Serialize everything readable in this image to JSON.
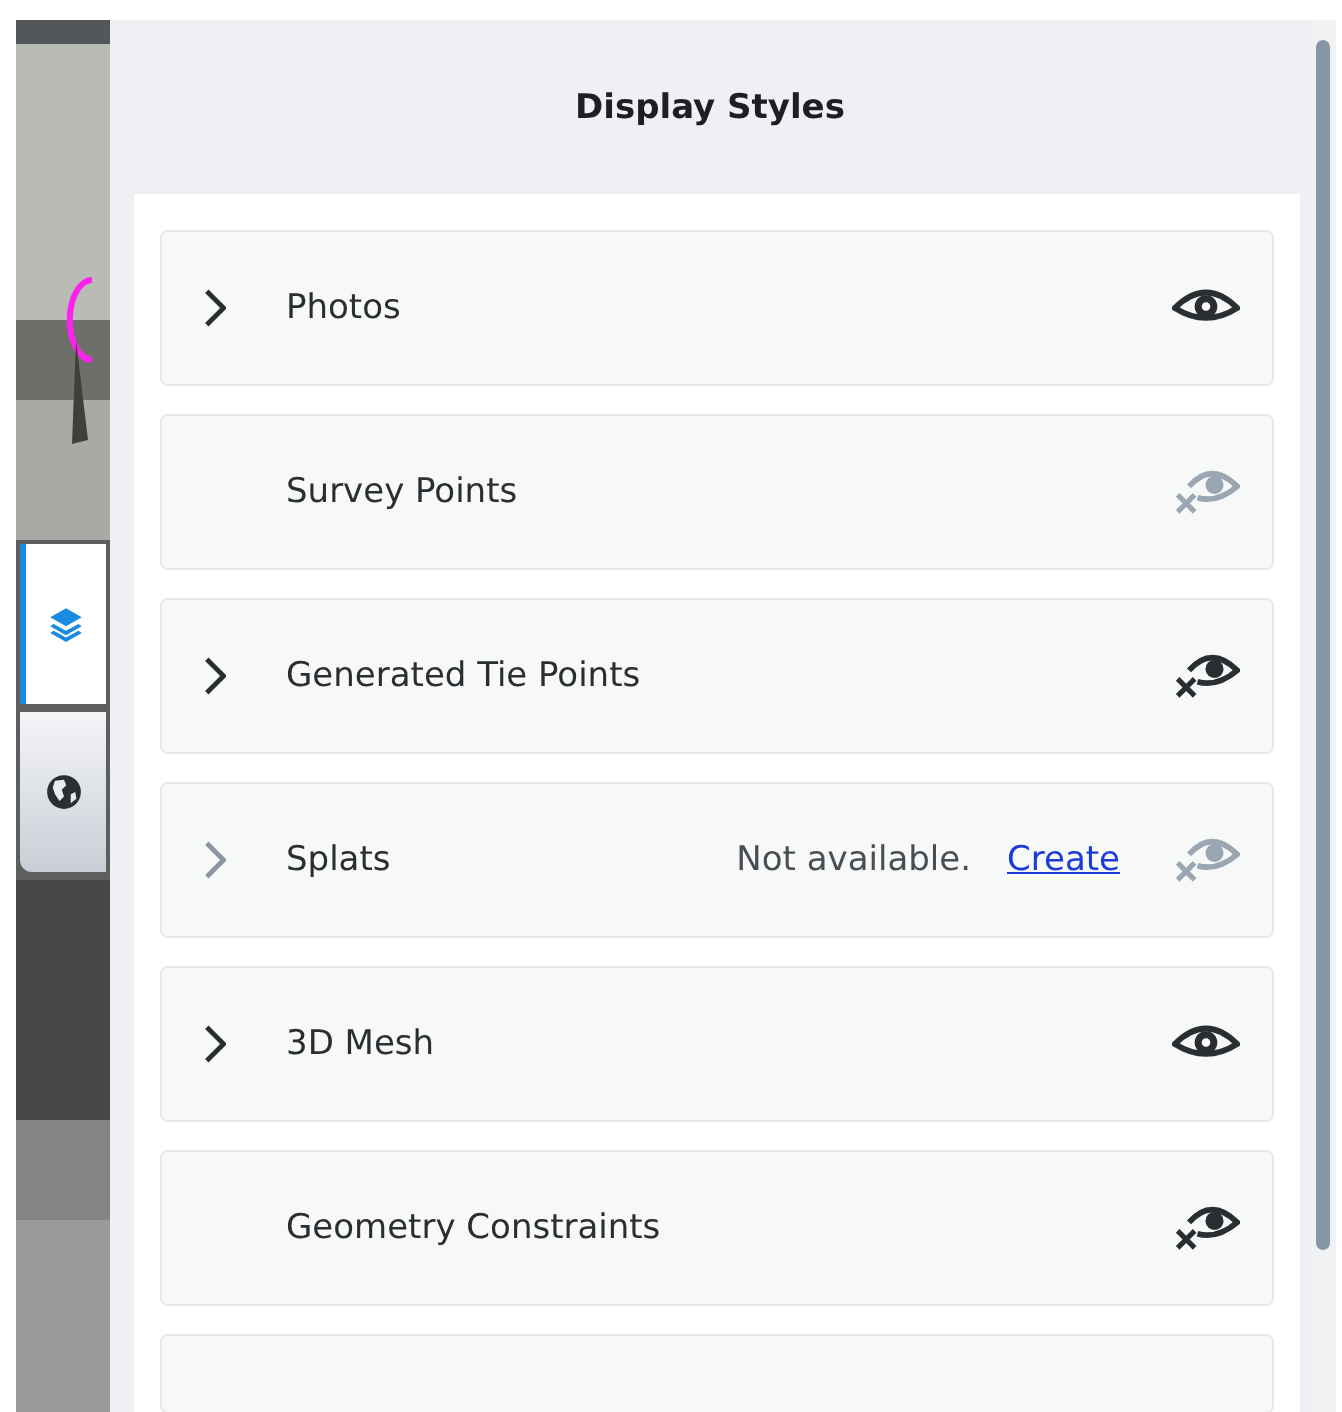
{
  "panel": {
    "title": "Display Styles"
  },
  "side_tabs": [
    {
      "selected": true
    },
    {
      "selected": false
    }
  ],
  "layers": [
    {
      "name": "Photos",
      "expandable": true,
      "disabled": false,
      "visible": true
    },
    {
      "name": "Survey Points",
      "expandable": false,
      "disabled": true,
      "visible": false
    },
    {
      "name": "Generated Tie Points",
      "expandable": true,
      "disabled": false,
      "visible": false
    },
    {
      "name": "Splats",
      "expandable": true,
      "disabled": true,
      "visible": false,
      "note": "Not available.",
      "link": "Create"
    },
    {
      "name": "3D Mesh",
      "expandable": true,
      "disabled": false,
      "visible": true
    },
    {
      "name": "Geometry Constraints",
      "expandable": false,
      "disabled": false,
      "visible": false
    }
  ]
}
